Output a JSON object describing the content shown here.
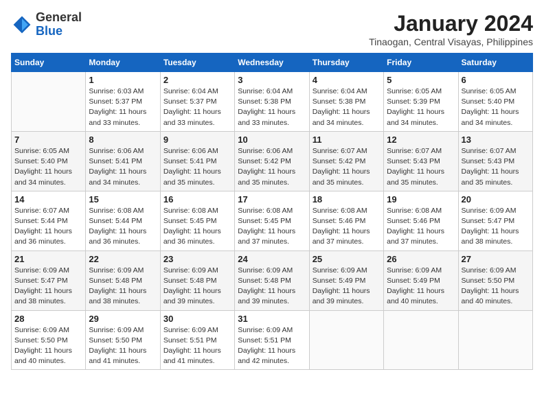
{
  "header": {
    "logo_general": "General",
    "logo_blue": "Blue",
    "title": "January 2024",
    "subtitle": "Tinaogan, Central Visayas, Philippines"
  },
  "days_of_week": [
    "Sunday",
    "Monday",
    "Tuesday",
    "Wednesday",
    "Thursday",
    "Friday",
    "Saturday"
  ],
  "weeks": [
    [
      {
        "day": "",
        "info": ""
      },
      {
        "day": "1",
        "info": "Sunrise: 6:03 AM\nSunset: 5:37 PM\nDaylight: 11 hours\nand 33 minutes."
      },
      {
        "day": "2",
        "info": "Sunrise: 6:04 AM\nSunset: 5:37 PM\nDaylight: 11 hours\nand 33 minutes."
      },
      {
        "day": "3",
        "info": "Sunrise: 6:04 AM\nSunset: 5:38 PM\nDaylight: 11 hours\nand 33 minutes."
      },
      {
        "day": "4",
        "info": "Sunrise: 6:04 AM\nSunset: 5:38 PM\nDaylight: 11 hours\nand 34 minutes."
      },
      {
        "day": "5",
        "info": "Sunrise: 6:05 AM\nSunset: 5:39 PM\nDaylight: 11 hours\nand 34 minutes."
      },
      {
        "day": "6",
        "info": "Sunrise: 6:05 AM\nSunset: 5:40 PM\nDaylight: 11 hours\nand 34 minutes."
      }
    ],
    [
      {
        "day": "7",
        "info": "Sunrise: 6:05 AM\nSunset: 5:40 PM\nDaylight: 11 hours\nand 34 minutes."
      },
      {
        "day": "8",
        "info": "Sunrise: 6:06 AM\nSunset: 5:41 PM\nDaylight: 11 hours\nand 34 minutes."
      },
      {
        "day": "9",
        "info": "Sunrise: 6:06 AM\nSunset: 5:41 PM\nDaylight: 11 hours\nand 35 minutes."
      },
      {
        "day": "10",
        "info": "Sunrise: 6:06 AM\nSunset: 5:42 PM\nDaylight: 11 hours\nand 35 minutes."
      },
      {
        "day": "11",
        "info": "Sunrise: 6:07 AM\nSunset: 5:42 PM\nDaylight: 11 hours\nand 35 minutes."
      },
      {
        "day": "12",
        "info": "Sunrise: 6:07 AM\nSunset: 5:43 PM\nDaylight: 11 hours\nand 35 minutes."
      },
      {
        "day": "13",
        "info": "Sunrise: 6:07 AM\nSunset: 5:43 PM\nDaylight: 11 hours\nand 35 minutes."
      }
    ],
    [
      {
        "day": "14",
        "info": "Sunrise: 6:07 AM\nSunset: 5:44 PM\nDaylight: 11 hours\nand 36 minutes."
      },
      {
        "day": "15",
        "info": "Sunrise: 6:08 AM\nSunset: 5:44 PM\nDaylight: 11 hours\nand 36 minutes."
      },
      {
        "day": "16",
        "info": "Sunrise: 6:08 AM\nSunset: 5:45 PM\nDaylight: 11 hours\nand 36 minutes."
      },
      {
        "day": "17",
        "info": "Sunrise: 6:08 AM\nSunset: 5:45 PM\nDaylight: 11 hours\nand 37 minutes."
      },
      {
        "day": "18",
        "info": "Sunrise: 6:08 AM\nSunset: 5:46 PM\nDaylight: 11 hours\nand 37 minutes."
      },
      {
        "day": "19",
        "info": "Sunrise: 6:08 AM\nSunset: 5:46 PM\nDaylight: 11 hours\nand 37 minutes."
      },
      {
        "day": "20",
        "info": "Sunrise: 6:09 AM\nSunset: 5:47 PM\nDaylight: 11 hours\nand 38 minutes."
      }
    ],
    [
      {
        "day": "21",
        "info": "Sunrise: 6:09 AM\nSunset: 5:47 PM\nDaylight: 11 hours\nand 38 minutes."
      },
      {
        "day": "22",
        "info": "Sunrise: 6:09 AM\nSunset: 5:48 PM\nDaylight: 11 hours\nand 38 minutes."
      },
      {
        "day": "23",
        "info": "Sunrise: 6:09 AM\nSunset: 5:48 PM\nDaylight: 11 hours\nand 39 minutes."
      },
      {
        "day": "24",
        "info": "Sunrise: 6:09 AM\nSunset: 5:48 PM\nDaylight: 11 hours\nand 39 minutes."
      },
      {
        "day": "25",
        "info": "Sunrise: 6:09 AM\nSunset: 5:49 PM\nDaylight: 11 hours\nand 39 minutes."
      },
      {
        "day": "26",
        "info": "Sunrise: 6:09 AM\nSunset: 5:49 PM\nDaylight: 11 hours\nand 40 minutes."
      },
      {
        "day": "27",
        "info": "Sunrise: 6:09 AM\nSunset: 5:50 PM\nDaylight: 11 hours\nand 40 minutes."
      }
    ],
    [
      {
        "day": "28",
        "info": "Sunrise: 6:09 AM\nSunset: 5:50 PM\nDaylight: 11 hours\nand 40 minutes."
      },
      {
        "day": "29",
        "info": "Sunrise: 6:09 AM\nSunset: 5:50 PM\nDaylight: 11 hours\nand 41 minutes."
      },
      {
        "day": "30",
        "info": "Sunrise: 6:09 AM\nSunset: 5:51 PM\nDaylight: 11 hours\nand 41 minutes."
      },
      {
        "day": "31",
        "info": "Sunrise: 6:09 AM\nSunset: 5:51 PM\nDaylight: 11 hours\nand 42 minutes."
      },
      {
        "day": "",
        "info": ""
      },
      {
        "day": "",
        "info": ""
      },
      {
        "day": "",
        "info": ""
      }
    ]
  ]
}
